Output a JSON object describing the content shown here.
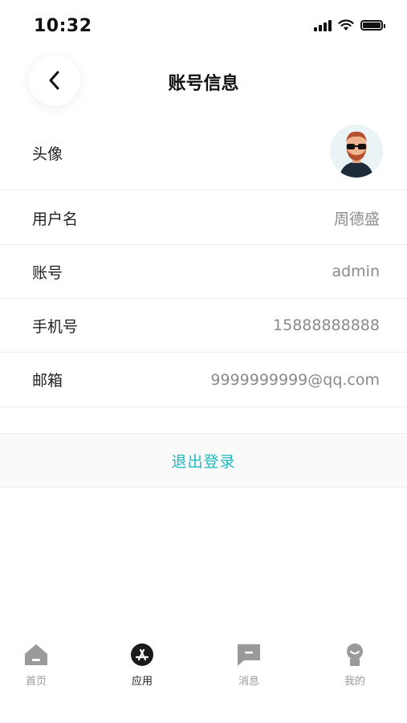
{
  "status_bar": {
    "time": "10:32"
  },
  "nav": {
    "title": "账号信息"
  },
  "profile": {
    "avatar_label": "头像",
    "username_label": "用户名",
    "username_value": "周德盛",
    "account_label": "账号",
    "account_value": "admin",
    "phone_label": "手机号",
    "phone_value": "15888888888",
    "email_label": "邮箱",
    "email_value": "9999999999@qq.com"
  },
  "logout": {
    "label": "退出登录",
    "color": "#1fb8c0"
  },
  "tabbar": {
    "items": [
      {
        "label": "首页",
        "icon": "home-icon",
        "active": false
      },
      {
        "label": "应用",
        "icon": "app-store-icon",
        "active": true
      },
      {
        "label": "消息",
        "icon": "message-icon",
        "active": false
      },
      {
        "label": "我的",
        "icon": "profile-icon",
        "active": false
      }
    ]
  }
}
